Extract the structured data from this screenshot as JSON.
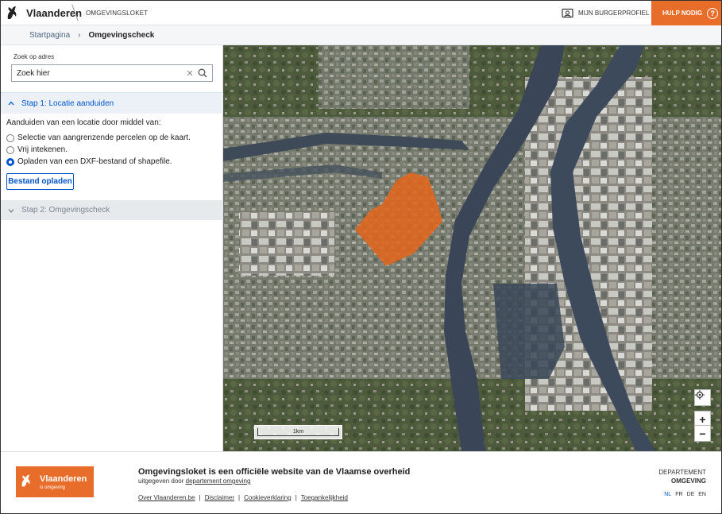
{
  "header": {
    "brand": "Vlaanderen",
    "subtitle": "OMGEVINGSLOKET",
    "profile_label": "MIJN BURGERPROFIEL",
    "help_label": "HULP NODIG",
    "help_icon": "?"
  },
  "breadcrumb": {
    "home": "Startpagina",
    "current": "Omgevingscheck"
  },
  "search": {
    "label": "Zoek op adres",
    "placeholder": "Zoek hier",
    "value": ""
  },
  "step1": {
    "title": "Stap 1: Locatie aanduiden",
    "intro": "Aanduiden van een locatie door middel van:",
    "options": [
      {
        "label": "Selectie van aangrenzende percelen op de kaart.",
        "selected": false
      },
      {
        "label": "Vrij intekenen.",
        "selected": false
      },
      {
        "label": "Opladen van een DXF-bestand of shapefile.",
        "selected": true
      }
    ],
    "upload_label": "Bestand opladen"
  },
  "step2": {
    "title": "Stap 2: Omgevingscheck"
  },
  "map": {
    "scale_label": "1km",
    "zoom_in": "+",
    "zoom_out": "−",
    "selection_color": "#e0651e"
  },
  "footer": {
    "logo_name": "Vlaanderen",
    "logo_tagline": "is omgeving",
    "title": "Omgevingsloket is een officiële website van de Vlaamse overheid",
    "published_prefix": "uitgegeven door",
    "published_link": "departement omgeving",
    "links": [
      "Over Vlaanderen.be",
      "Disclaimer",
      "Cookieverklaring",
      "Toegankelijkheid"
    ],
    "separators": [
      "|",
      "|",
      "|"
    ],
    "dept_line1": "DEPARTEMENT",
    "dept_line2": "OMGEVING",
    "languages": [
      "NL",
      "FR",
      "DE",
      "EN"
    ],
    "current_language": "NL"
  },
  "colors": {
    "brand_orange": "#e96d2a",
    "link_blue": "#0055cc"
  }
}
